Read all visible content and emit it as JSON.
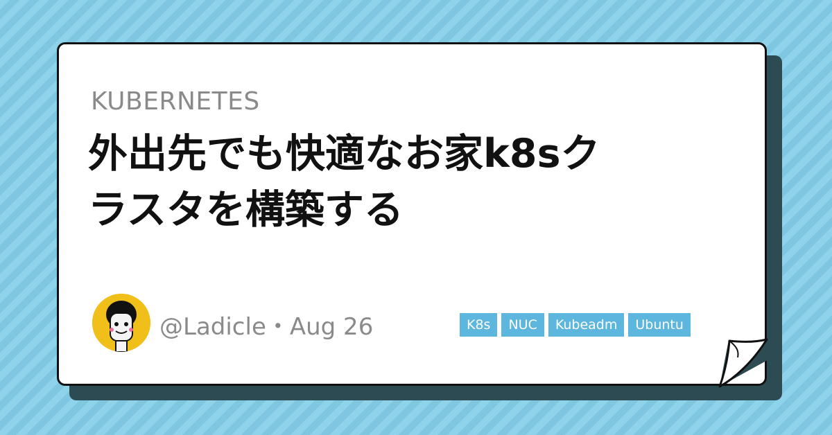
{
  "category": "KUBERNETES",
  "title_line1": "外出先でも快適なお家k8sク",
  "title_line2": "ラスタを構築する",
  "author": "@Ladicle・Aug 26",
  "tags": [
    "K8s",
    "NUC",
    "Kubeadm",
    "Ubuntu"
  ],
  "colors": {
    "background": "#8fd3ea",
    "card": "#ffffff",
    "tag": "#5cb6dd",
    "avatar_bg": "#f0bf19"
  },
  "icons": {
    "avatar": "avatar-icon"
  }
}
